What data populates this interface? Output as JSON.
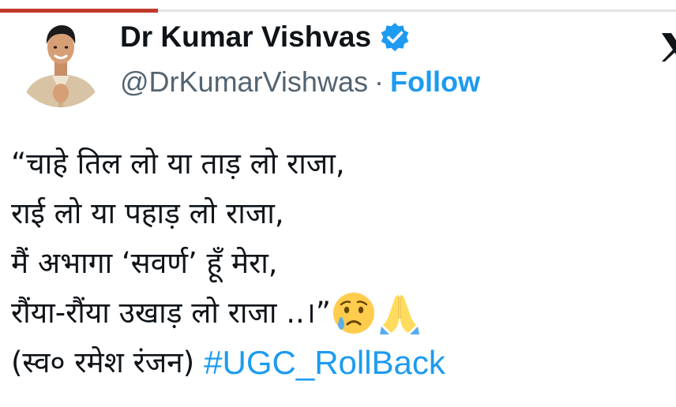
{
  "author": {
    "name": "Dr Kumar Vishvas",
    "handle": "@DrKumarVishwas",
    "separator": "·",
    "follow_label": "Follow",
    "verified_icon": "verified-badge-icon"
  },
  "tweet": {
    "lines": [
      "“चाहे तिल लो या ताड़ लो राजा,",
      "राई लो या पहाड़ लो राजा,",
      "मैं अभागा ‘सवर्ण’ हूँ मेरा,",
      "रौंया-रौंया उखाड़ लो राजा ..।”"
    ],
    "attribution": "(स्व० रमेश रंजन)",
    "hashtag": "#UGC_RollBack",
    "emojis": [
      "crying-face-emoji",
      "folded-hands-emoji"
    ]
  },
  "colors": {
    "accent": "#1d9bf0",
    "text": "#0f1419",
    "secondary": "#536471",
    "progress": "#c0392b"
  }
}
